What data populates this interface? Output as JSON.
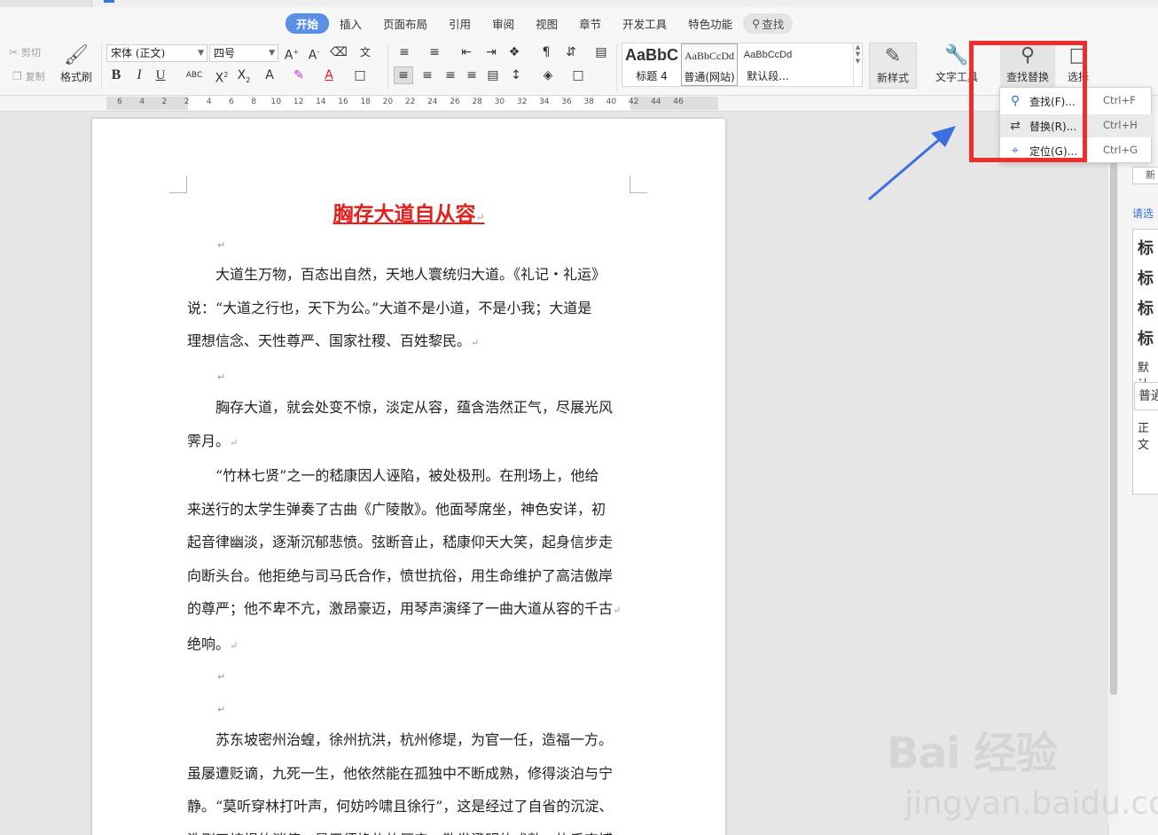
{
  "menu": {
    "tabs": [
      "开始",
      "插入",
      "页面布局",
      "引用",
      "审阅",
      "视图",
      "章节",
      "开发工具",
      "特色功能"
    ],
    "search_label": "查找"
  },
  "clipboard": {
    "cut": "剪切",
    "copy": "复制",
    "format_painter": "格式刷"
  },
  "font": {
    "family": "宋体 (正文)",
    "size": "四号"
  },
  "styles": [
    {
      "preview": "AaBbC",
      "name": "标题 4"
    },
    {
      "preview": "AaBbCcDd",
      "name": "普通(网站)"
    },
    {
      "preview": "AaBbCcDd",
      "name": "默认段..."
    }
  ],
  "ribbon_buttons": {
    "new_style": "新样式",
    "text_tools": "文字工具",
    "find_replace": "查找替换",
    "select": "选择"
  },
  "ruler_ticks": [
    "6",
    "4",
    "2",
    "2",
    "4",
    "6",
    "8",
    "10",
    "12",
    "14",
    "16",
    "18",
    "20",
    "22",
    "24",
    "26",
    "28",
    "30",
    "32",
    "34",
    "36",
    "38",
    "40",
    "42",
    "44",
    "46"
  ],
  "dropdown": {
    "items": [
      {
        "label": "查找(F)...",
        "shortcut": "Ctrl+F",
        "icon": "search-icon"
      },
      {
        "label": "替换(R)...",
        "shortcut": "Ctrl+H",
        "icon": "replace-icon"
      },
      {
        "label": "定位(G)...",
        "shortcut": "Ctrl+G",
        "icon": "locate-icon"
      }
    ]
  },
  "document": {
    "title": "胸存大道自从容",
    "paragraph_mark": "↵",
    "lines": [
      "　　大道生万物，百态出自然，天地人寰统归大道。《礼记・礼运》",
      "说：“大道之行也，天下为公。”大道不是小道，不是小我；大道是",
      "理想信念、天性尊严、国家社稷、百姓黎民。",
      "　　胸存大道，就会处变不惊，淡定从容，蕴含浩然正气，尽展光风",
      "霁月。",
      "　　“竹林七贤”之一的嵇康因人诬陷，被处极刑。在刑场上，他给",
      "来送行的太学生弹奏了古曲《广陵散》。他面琴席坐，神色安详，初",
      "起音律幽淡，逐渐沉郁悲愤。弦断音止，嵇康仰天大笑，起身信步走",
      "向断头台。他拒绝与司马氏合作，愤世抗俗，用生命维护了高洁傲岸",
      "的尊严；他不卑不亢，激昂豪迈，用琴声演绎了一曲大道从容的千古",
      "绝响。",
      "　　苏东坡密州治蝗，徐州抗洪，杭州修堤，为官一任，造福一方。",
      "虽屡遭贬谪，九死一生，他依然能在孤独中不断成熟，修得淡泊与宁",
      "静。“莫听穿林打叶声，何妨吟啸且徐行”，这是经过了自省的沉淀、",
      "洗刷了惊惧的消停，是无须挣扎的厚实，散发澄明的成熟，执乎宏博"
    ]
  },
  "right_panel": {
    "new_label": "新",
    "prompt": "请选",
    "heading_items": [
      "标",
      "标",
      "标",
      "标"
    ],
    "default_label": "默认",
    "box_label": "普通",
    "body_label": "正文"
  },
  "watermark": {
    "logo": "Bai 经验",
    "url": "jingyan.baidu.com"
  },
  "colors": {
    "accent": "#5b8ee6",
    "title_red": "#e3201c",
    "highlight_box": "#ee2d2d",
    "arrow_blue": "#3c6fe0"
  }
}
